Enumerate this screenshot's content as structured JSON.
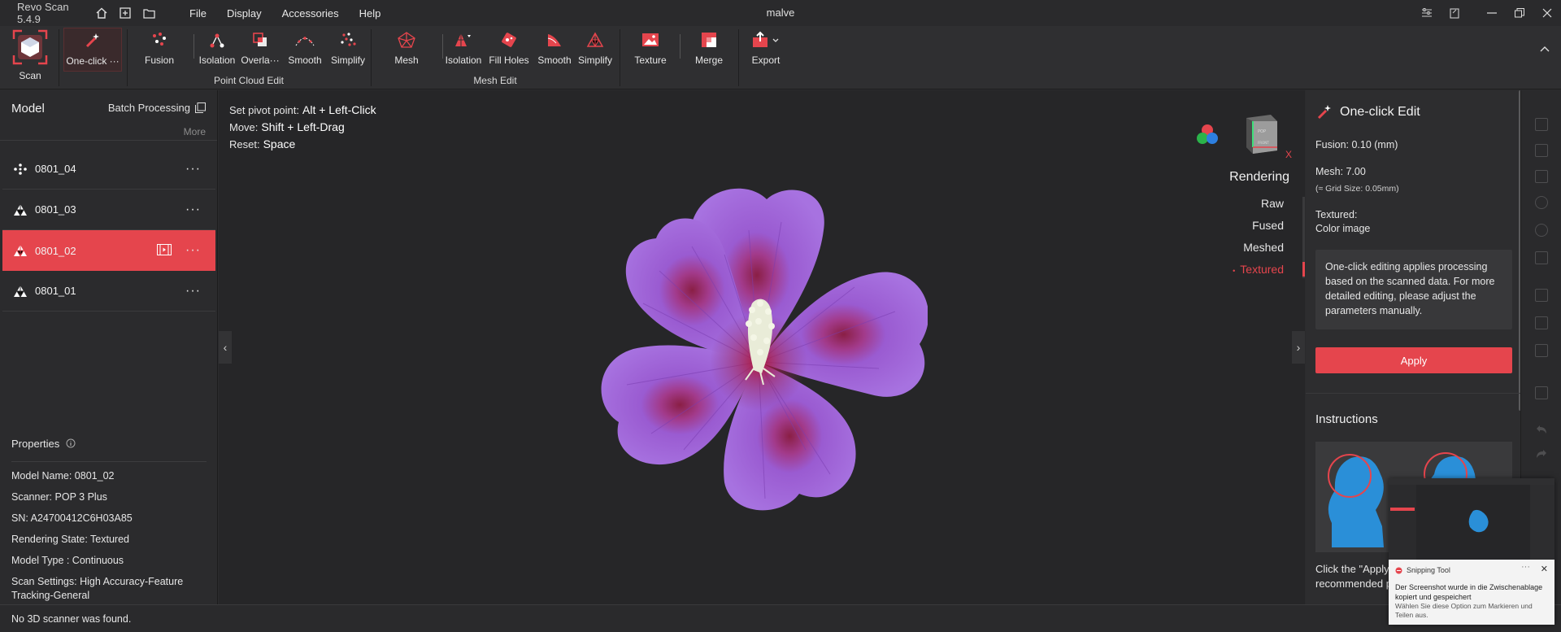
{
  "app": {
    "name": "Revo Scan 5.4.9",
    "document_title": "malve"
  },
  "menu": [
    "File",
    "Display",
    "Accessories",
    "Help"
  ],
  "ribbon": {
    "scan": "Scan",
    "one_click": "One-click ···",
    "point_cloud": [
      "Fusion",
      "Isolation",
      "Overla···",
      "Smooth",
      "Simplify"
    ],
    "point_cloud_group": "Point Cloud Edit",
    "mesh": [
      "Mesh",
      "Isolation",
      "Fill Holes",
      "Smooth",
      "Simplify"
    ],
    "mesh_group": "Mesh Edit",
    "texture": "Texture",
    "merge": "Merge",
    "export": "Export"
  },
  "left_panel": {
    "title": "Model",
    "batch": "Batch Processing",
    "more": "More",
    "models": [
      {
        "name": "0801_04",
        "icon": "point-cloud-icon",
        "active": false
      },
      {
        "name": "0801_03",
        "icon": "mesh-icon",
        "active": false
      },
      {
        "name": "0801_02",
        "icon": "mesh-icon",
        "active": true
      },
      {
        "name": "0801_01",
        "icon": "mesh-icon",
        "active": false
      }
    ],
    "row_menu": "···",
    "properties_title": "Properties",
    "properties": [
      "Model Name:  0801_02",
      "Scanner:  POP 3 Plus",
      "SN:  A24700412C6H03A85",
      "Rendering State:  Textured",
      "Model Type :  Continuous",
      "Scan Settings:  High Accuracy-Feature Tracking-General"
    ]
  },
  "viewport": {
    "hints": [
      {
        "label": "Set pivot point:",
        "key": "Alt + Left-Click"
      },
      {
        "label": "Move:",
        "key": "Shift + Left-Drag"
      },
      {
        "label": "Reset:",
        "key": "Space"
      }
    ],
    "rendering_title": "Rendering",
    "rendering_options": [
      "Raw",
      "Fused",
      "Meshed",
      "Textured"
    ],
    "rendering_active": "Textured",
    "viewcube_axis": "X",
    "nav_left": "‹",
    "nav_right": "›"
  },
  "right_panel": {
    "title": "One-click Edit",
    "fusion": "Fusion:  0.10 (mm)",
    "mesh": "Mesh:  7.00",
    "grid": "(≈ Grid Size: 0.05mm)",
    "textured_label": "Textured:",
    "textured_value": "Color image",
    "note": "One-click editing applies processing based on the scanned data. For more detailed editing, please adjust the parameters manually.",
    "apply": "Apply",
    "instructions_title": "Instructions",
    "instructions_text": "Click the \"Apply\" generate a 3D m recommended p"
  },
  "status": "No 3D scanner was found.",
  "toast": {
    "app": "Snipping Tool",
    "message": "Der Screenshot wurde in die Zwischenablage kopiert und gespeichert",
    "sub": "Wählen Sie diese Option zum Markieren und Teilen aus.",
    "min": "···",
    "close": "✕"
  },
  "colors": {
    "accent": "#e5454d",
    "flower": "#9a5bd1",
    "flower_center": "#a0203e"
  }
}
